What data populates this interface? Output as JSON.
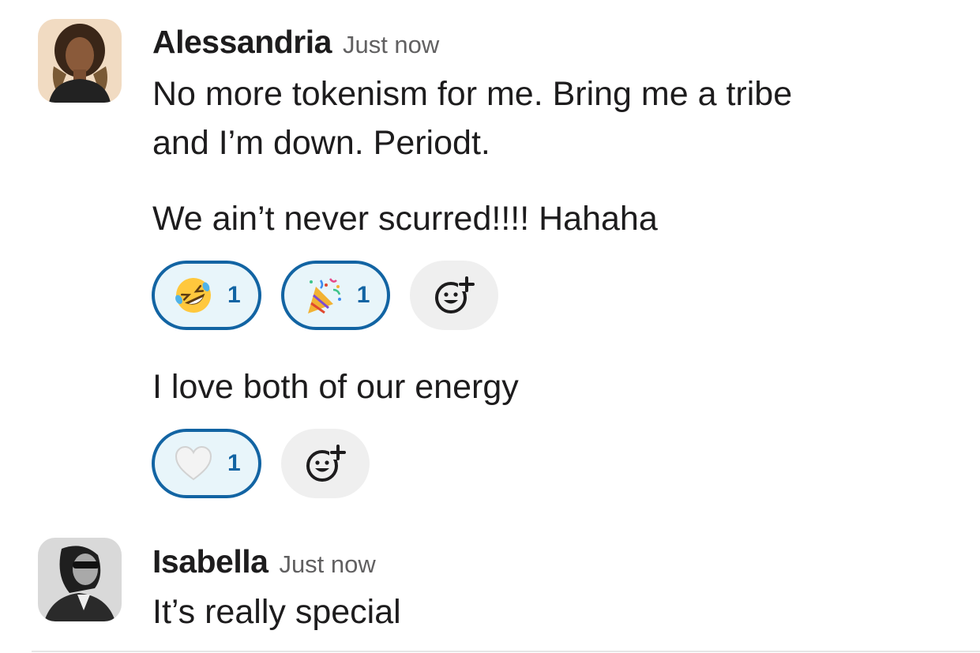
{
  "messages": [
    {
      "sender": "Alessandria",
      "timestamp": "Just now",
      "lines": [
        "No more tokenism for me.  Bring me a tribe",
        "and I’m down.  Periodt."
      ]
    },
    {
      "text": "We ain’t never scurred!!!!   Hahaha",
      "reactions": [
        {
          "emoji": "rolling-on-floor-laughing",
          "count": "1"
        },
        {
          "emoji": "party-popper",
          "count": "1"
        }
      ]
    },
    {
      "text": "I love both of our energy",
      "reactions": [
        {
          "emoji": "white-heart",
          "count": "1"
        }
      ]
    },
    {
      "sender": "Isabella",
      "timestamp": "Just now",
      "lines": [
        "It’s really special"
      ]
    }
  ],
  "icons": {
    "add_reaction": "add-reaction-icon"
  },
  "colors": {
    "accent": "#1264a3",
    "reaction_bg": "#e8f5fa",
    "text": "#1d1c1d",
    "muted": "#616061"
  }
}
